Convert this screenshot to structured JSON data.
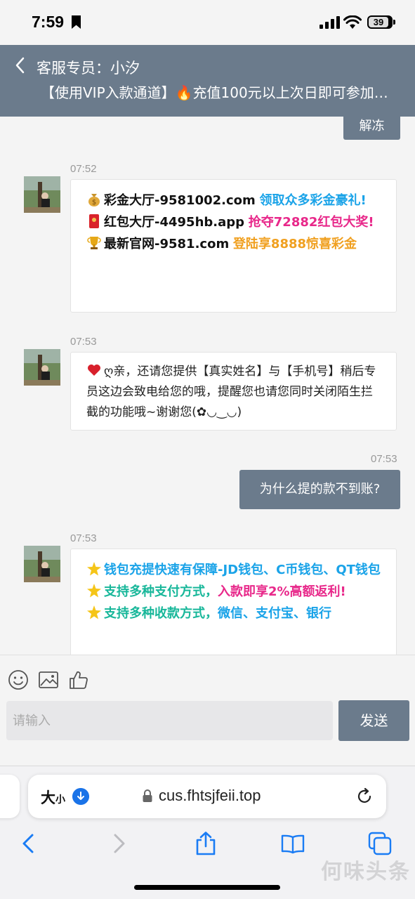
{
  "status_bar": {
    "time": "7:59",
    "battery": "39"
  },
  "header": {
    "title": "客服专员：小汐",
    "marquee": "【使用VIP入款通道】🔥充值100元以上次日即可参加以..."
  },
  "chat": {
    "unfreeze_button": "解冻",
    "messages": [
      {
        "time": "07:52",
        "lines": [
          {
            "emoji": "money-bag",
            "bold": "彩金大厅-9581002.com",
            "accent": "领取众多彩金豪礼!"
          },
          {
            "emoji": "red-envelope",
            "bold": "红包大厅-4495hb.app",
            "accent": "抢夺72882红包大奖!"
          },
          {
            "emoji": "trophy",
            "bold": "最新官网-9581.com",
            "accent": "登陆享8888惊喜彩金"
          }
        ]
      },
      {
        "time": "07:53",
        "text": "ღ亲，还请您提供【真实姓名】与【手机号】稍后专员这边会致电给您的哦，提醒您也请您同时关闭陌生拦截的功能哦~谢谢您(✿◡‿◡)"
      },
      {
        "time": "07:53",
        "outgoing": "为什么提的款不到账?"
      },
      {
        "time": "07:53",
        "lines": [
          {
            "emoji": "glowing-star",
            "text": "钱包充提快速有保障-JD钱包、C币钱包、QT钱包"
          },
          {
            "emoji": "glowing-star",
            "text_a": "支持多种支付方式，",
            "text_b": "入款即享2%高额返利!"
          },
          {
            "emoji": "glowing-star",
            "text_a": "支持多种收款方式，",
            "text_b": "微信、支付宝、银行"
          }
        ]
      }
    ]
  },
  "composer": {
    "placeholder": "请输入",
    "send_label": "发送"
  },
  "browser": {
    "aa_big": "大",
    "aa_small": "小",
    "url": "cus.fhtsjfeii.top"
  },
  "watermark": "何味头条",
  "colors": {
    "header": "#6b7b8c",
    "accent_blue": "#1aa3e8",
    "accent_pink": "#e8288a",
    "accent_orange": "#f0a020",
    "accent_teal": "#18b79a"
  }
}
